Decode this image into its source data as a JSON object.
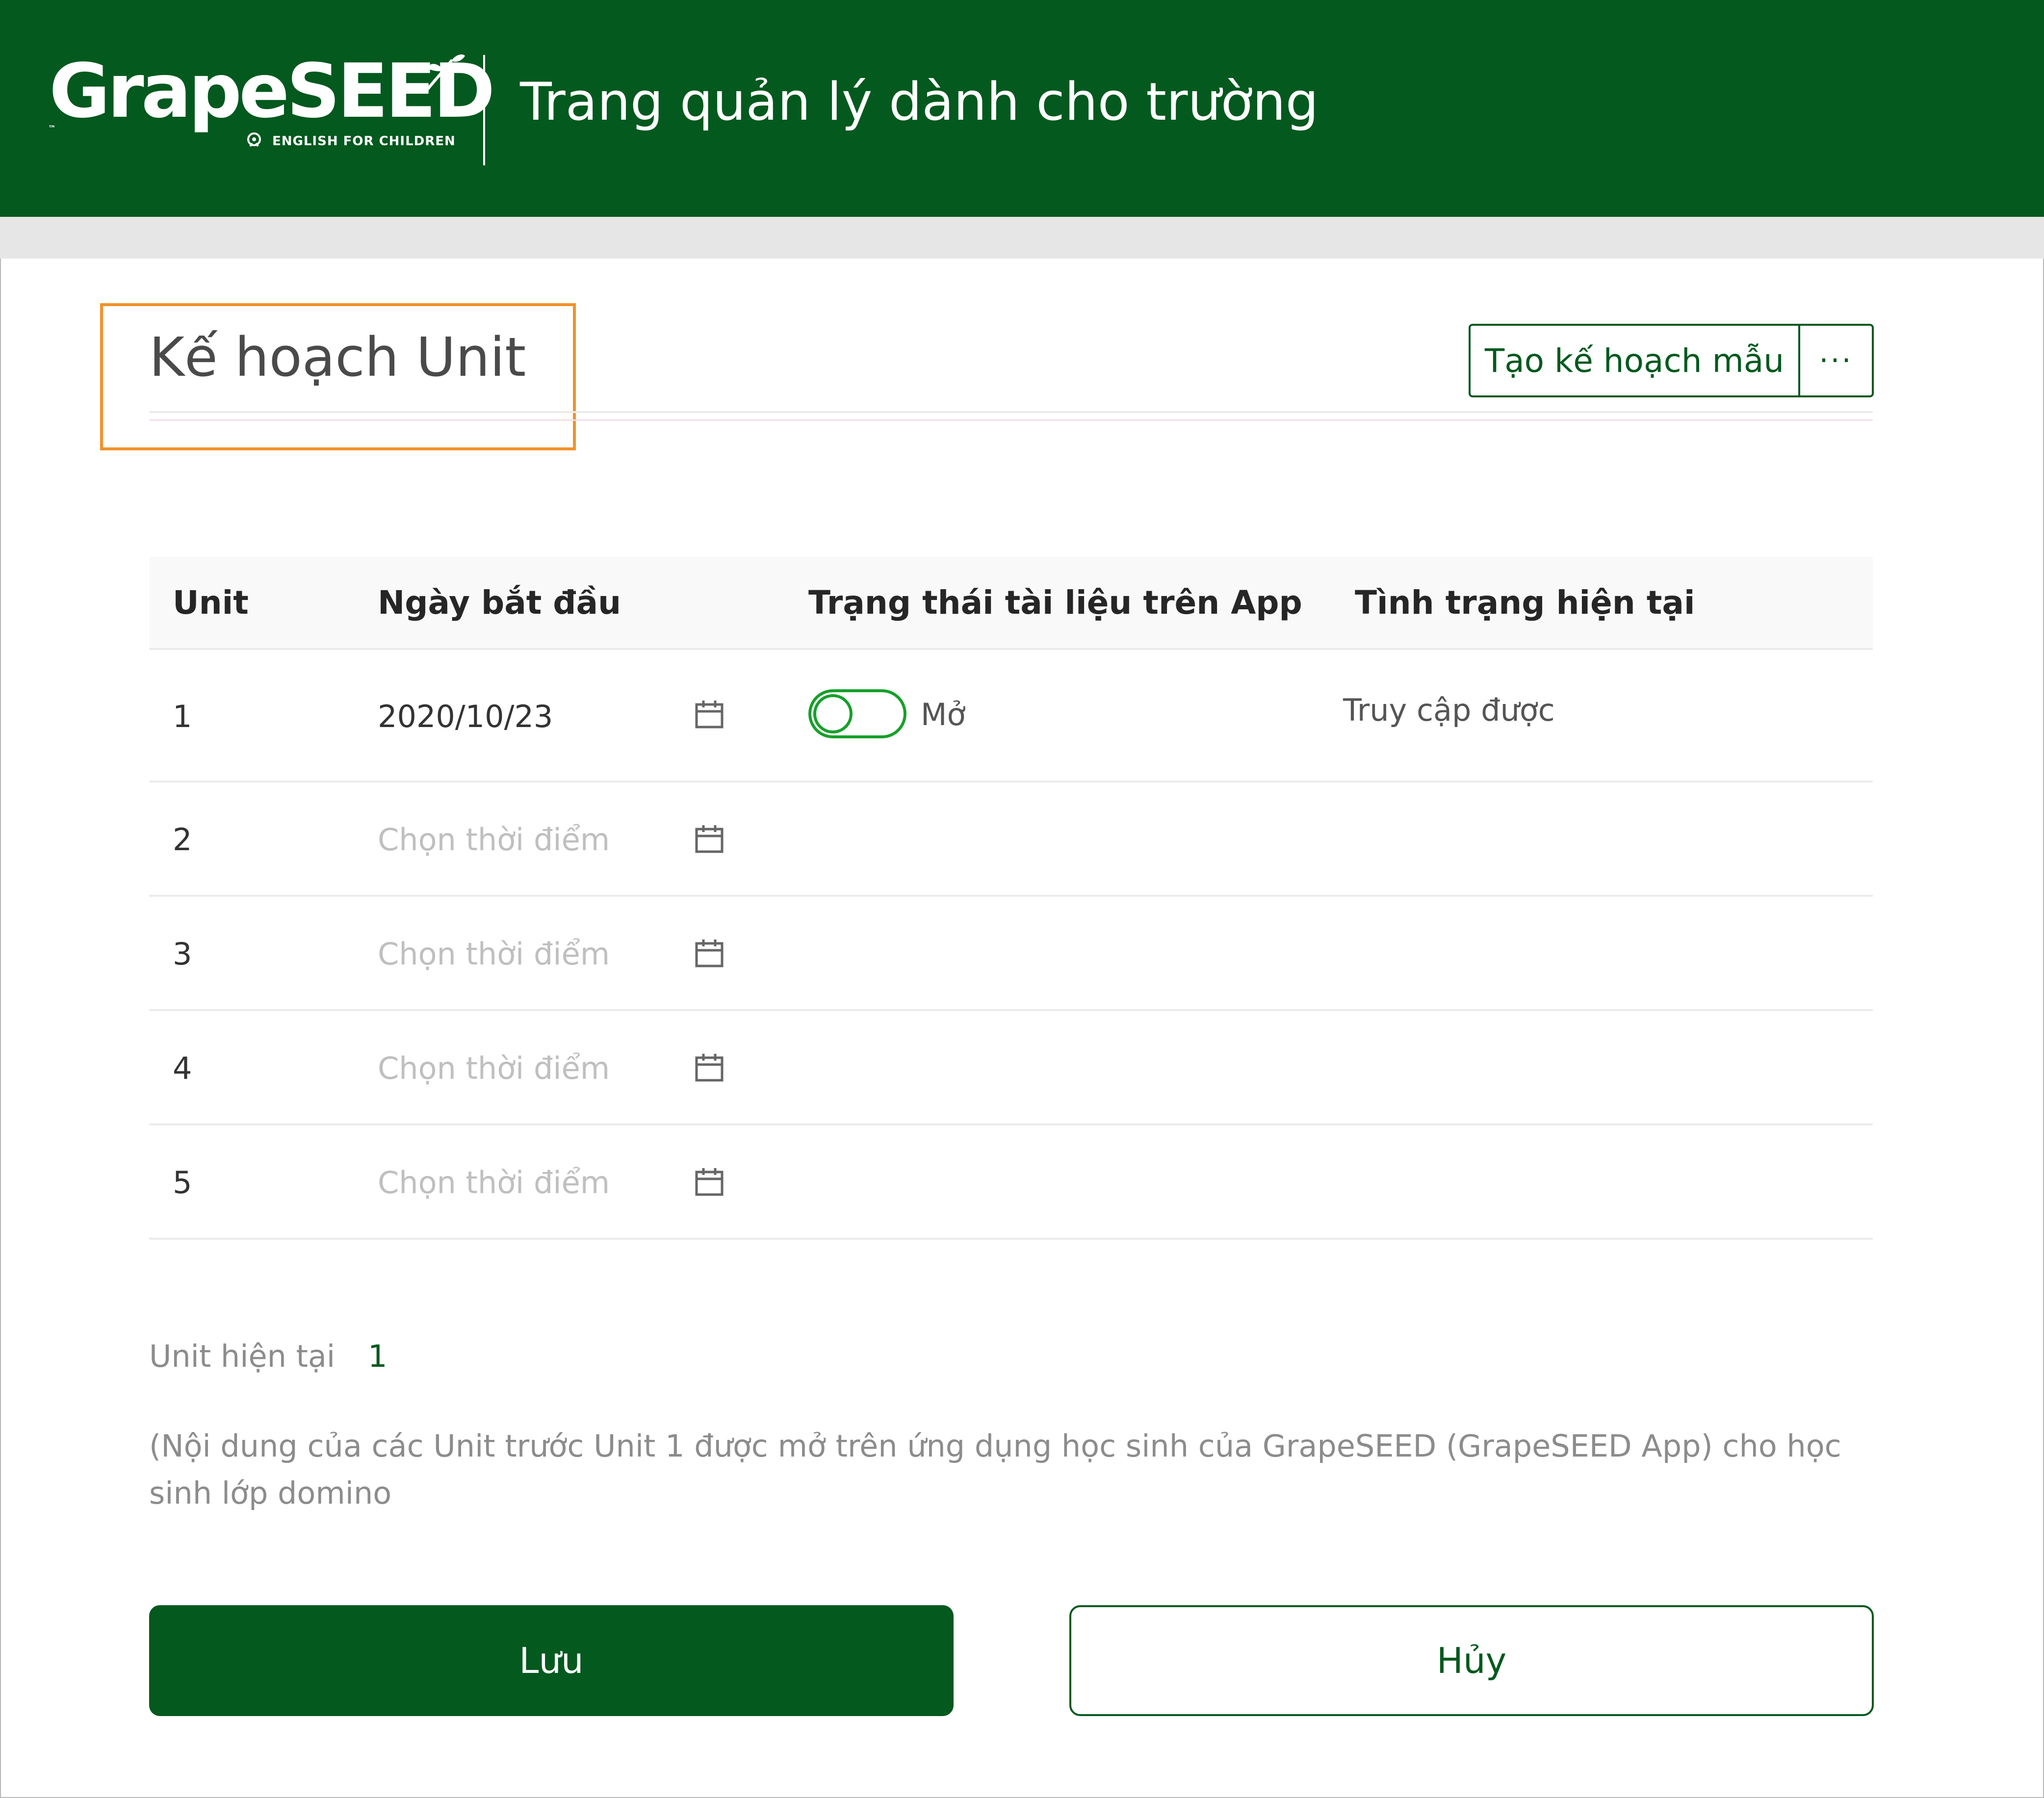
{
  "header": {
    "logo_text": "GrapeSEED",
    "logo_tagline": "ENGLISH FOR CHILDREN",
    "logo_tm": "™",
    "title": "Trang quản lý dành cho trường"
  },
  "page": {
    "title": "Kế hoạch Unit",
    "template_button": "Tạo kế hoạch mẫu",
    "more_button": "···"
  },
  "table": {
    "columns": [
      "Unit",
      "Ngày bắt đầu",
      "Trạng thái tài liệu trên App",
      "Tình trạng hiện tại"
    ],
    "rows": [
      {
        "unit": "1",
        "date": "2020/10/23",
        "toggle_label": "Mở",
        "toggle_on": false,
        "status": "Truy cập được"
      },
      {
        "unit": "2",
        "date_placeholder": "Chọn thời điểm"
      },
      {
        "unit": "3",
        "date_placeholder": "Chọn thời điểm"
      },
      {
        "unit": "4",
        "date_placeholder": "Chọn thời điểm"
      },
      {
        "unit": "5",
        "date_placeholder": "Chọn thời điểm"
      }
    ]
  },
  "footer": {
    "current_unit_label": "Unit hiện tại",
    "current_unit_value": "1",
    "note": "(Nội dung của các Unit trước Unit 1 được mở trên ứng dụng học sinh của GrapeSEED (GrapeSEED App) cho học sinh lớp domino"
  },
  "actions": {
    "save": "Lưu",
    "cancel": "Hủy"
  },
  "colors": {
    "brand_green": "#03591e",
    "toggle_green": "#16a02a",
    "highlight_orange": "#f0922a"
  },
  "icons": {
    "calendar": "calendar-icon",
    "sprout": "sprout-icon"
  }
}
